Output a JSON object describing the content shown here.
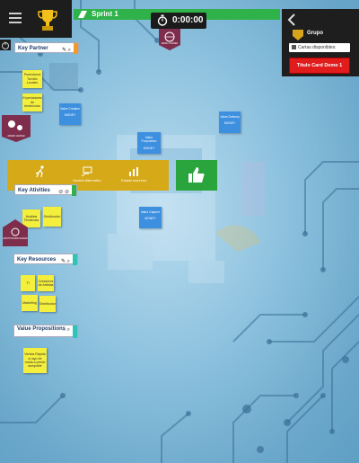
{
  "topbar": {
    "menu_icon": "hamburger-icon",
    "trophy_icon": "trophy-icon"
  },
  "sprint": {
    "label": "Sprint 1",
    "color": "#2fb24a"
  },
  "timer": {
    "value": "0:00:00"
  },
  "group_panel": {
    "title": "Grupo",
    "cards_button": "Cartas disponibles:",
    "card_title": "Título Card Demo 1"
  },
  "sections": {
    "key_partner": "Key Partner",
    "key_activities": "Key Ativities",
    "key_resources": "Key Resources",
    "value_propositions": "Value Propositions"
  },
  "notes": {
    "partner": [
      "Promotores Turístic Locales",
      "Experiadores de tendencias"
    ],
    "activities": [
      "Análisis Tendencia",
      "Distribución"
    ],
    "resources": [
      "TI",
      "Creadores de Artistas",
      "Marketing",
      "Distribuidor"
    ],
    "value": [
      "Ventas Rápida a rayo de moda a precio asequible"
    ]
  },
  "blue_cards": {
    "value_creation": {
      "title": "Value Creation",
      "tag": "MONEY"
    },
    "value_proposition": {
      "title": "Value Proposition",
      "tag": "MONEY"
    },
    "value_delivery": {
      "title": "Value Delivery",
      "tag": "MONEY"
    },
    "value_capture": {
      "title": "Value Capture",
      "tag": "MONEY"
    }
  },
  "gold_band_items": [
    "",
    "Modelo Alternativo",
    "Estado empresa"
  ],
  "badges": {
    "top_center": "MADE / PASSED",
    "left_mid": "AWARD CENTER",
    "left_lower": "MONTH BOARD LEADER"
  }
}
